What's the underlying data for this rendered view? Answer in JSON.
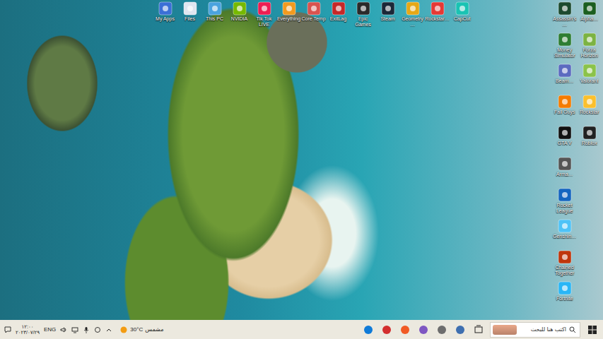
{
  "desktop": {
    "top_icons": [
      {
        "label": "My Apps",
        "color": "#3b6fd6"
      },
      {
        "label": "Files",
        "color": "#e0e6f0"
      },
      {
        "label": "This PC",
        "color": "#4aa3df"
      },
      {
        "label": "NVIDIA",
        "color": "#76b900"
      },
      {
        "label": "Tik Tok LIVE",
        "color": "#ee1d52"
      },
      {
        "label": "Everything",
        "color": "#f29a1f"
      },
      {
        "label": "Core Temp",
        "color": "#d9534f"
      },
      {
        "label": "ExitLag",
        "color": "#c62828"
      },
      {
        "label": "Epic Games",
        "color": "#2a2a2a"
      },
      {
        "label": "Steam",
        "color": "#1b2838"
      },
      {
        "label": "Geometry…",
        "color": "#e6a817"
      },
      {
        "label": "Rockstar…",
        "color": "#e53935"
      },
      {
        "label": "CapCut",
        "color": "#19c3b3"
      }
    ],
    "side_icons_left": [
      {
        "label": "Assassin's…",
        "color": "#1c4a2e"
      },
      {
        "label": "Money Simulator",
        "color": "#2e7d32"
      },
      {
        "label": "Beam…",
        "color": "#5c6bc0"
      },
      {
        "label": "Fall Guys",
        "color": "#f57c00"
      },
      {
        "label": "GTA V",
        "color": "#111111"
      },
      {
        "label": "Arma…",
        "color": "#555555"
      },
      {
        "label": "Rocket League",
        "color": "#1565c0"
      },
      {
        "label": "Genshin…",
        "color": "#4fc3f7"
      },
      {
        "label": "Chained Together",
        "color": "#bf360c"
      },
      {
        "label": "Fortnite",
        "color": "#29b6f6"
      }
    ],
    "side_icons_right": [
      {
        "label": "Alpha…",
        "color": "#1b5e20"
      },
      {
        "label": "Forza Horizon",
        "color": "#7cb342"
      },
      {
        "label": "Valorant",
        "color": "#8bc34a"
      },
      {
        "label": "Rockstar",
        "color": "#fbc02d"
      },
      {
        "label": "Roblox",
        "color": "#212121"
      }
    ]
  },
  "taskbar": {
    "search": {
      "placeholder": "اكتب هنا للبحث"
    },
    "pinned": [
      {
        "color": "#0f7bd8"
      },
      {
        "color": "#d32f2f"
      },
      {
        "color": "#f15a24"
      },
      {
        "color": "#7e57c2"
      },
      {
        "color": "#6d6d6d"
      },
      {
        "color": "#3e6fb0"
      }
    ],
    "weather": {
      "temperature": "30°C",
      "condition": "مشمس"
    },
    "language": "ENG",
    "clock": {
      "time": "١٢:٠٠",
      "date": "٢٠٢٣/٠٧/٢٩"
    }
  }
}
